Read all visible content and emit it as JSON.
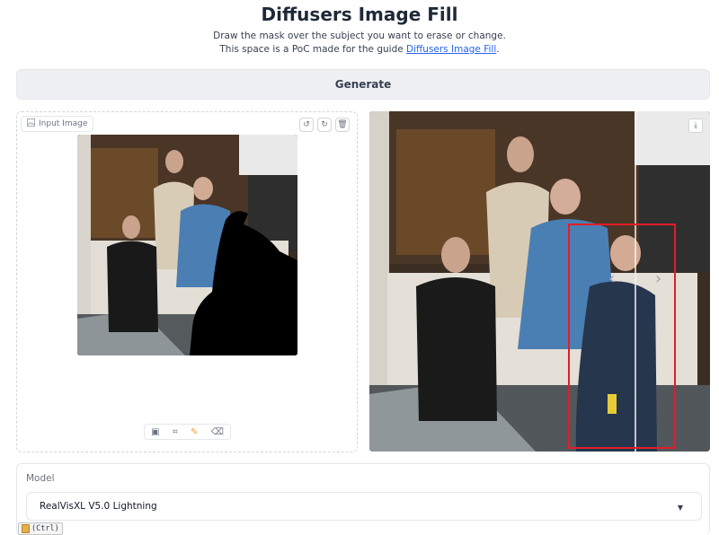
{
  "header": {
    "title": "Diffusers Image Fill",
    "description_line1": "Draw the mask over the subject you want to erase or change.",
    "description_line2_prefix": "This space is a PoC made for the guide ",
    "description_link": "Diffusers Image Fill",
    "description_line2_suffix": "."
  },
  "generate_button": {
    "label": "Generate"
  },
  "input_panel": {
    "label": "Input Image",
    "toolbar_icons": [
      "undo-icon",
      "redo-icon",
      "trash-icon"
    ],
    "edit_tools": [
      "image-icon",
      "crop-icon",
      "brush-icon",
      "eraser-icon"
    ]
  },
  "output_panel": {
    "toolbar_icons": [
      "download-icon"
    ],
    "slider_icons": [
      "chevron-left-icon",
      "chevron-right-icon"
    ]
  },
  "model": {
    "label": "Model",
    "selected": "RealVisXL V5.0 Lightning"
  },
  "shortcut_badge": {
    "label": "(Ctrl)"
  },
  "colors": {
    "link": "#2563eb",
    "mask": "#000000",
    "highlight_box": "#e11d2a",
    "button_bg": "#eef0f3"
  }
}
